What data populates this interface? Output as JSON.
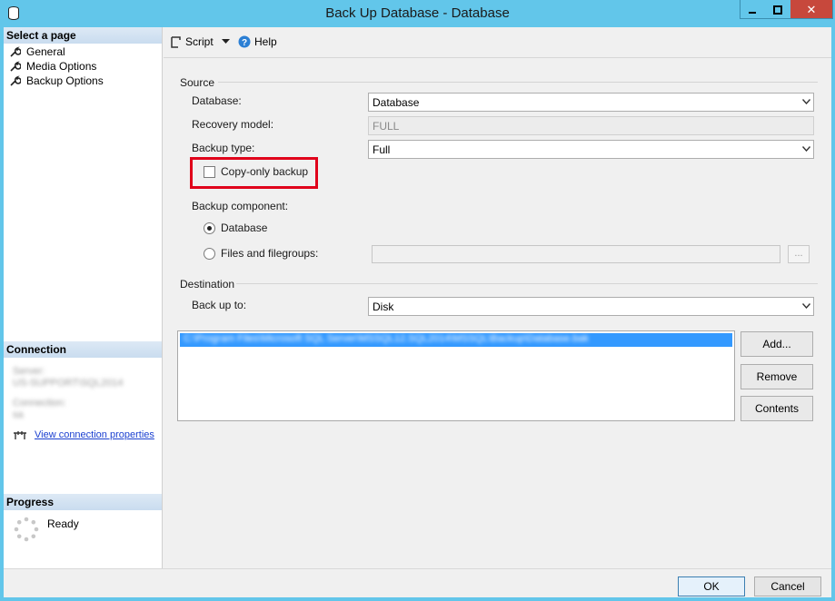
{
  "window": {
    "title": "Back Up Database - Database"
  },
  "sidebar": {
    "select_page_header": "Select a page",
    "pages": [
      {
        "label": "General",
        "icon": "wrench-icon"
      },
      {
        "label": "Media Options",
        "icon": "wrench-icon"
      },
      {
        "label": "Backup Options",
        "icon": "wrench-icon"
      }
    ],
    "connection_header": "Connection",
    "server_label": "Server:",
    "server_value": "US-SUPPORT\\SQL2014",
    "connection_label": "Connection:",
    "connection_value": "sa",
    "view_connection_link": "View connection properties",
    "progress_header": "Progress",
    "progress_status": "Ready"
  },
  "toolbar": {
    "script_label": "Script",
    "help_label": "Help"
  },
  "source": {
    "group_label": "Source",
    "database_label": "Database:",
    "database_value": "Database",
    "recovery_label": "Recovery model:",
    "recovery_value": "FULL",
    "backup_type_label": "Backup type:",
    "backup_type_value": "Full",
    "copy_only_label": "Copy-only backup",
    "copy_only_checked": false,
    "component_label": "Backup component:",
    "component_options": [
      {
        "label": "Database",
        "selected": true
      },
      {
        "label": "Files and filegroups:",
        "selected": false
      }
    ],
    "ellipsis_label": "..."
  },
  "destination": {
    "group_label": "Destination",
    "backup_to_label": "Back up to:",
    "backup_to_value": "Disk",
    "items": [
      "C:\\Program Files\\Microsoft SQL Server\\MSSQL12.SQL2014\\MSSQL\\Backup\\Database.bak"
    ],
    "add_label": "Add...",
    "remove_label": "Remove",
    "contents_label": "Contents"
  },
  "footer": {
    "ok_label": "OK",
    "cancel_label": "Cancel"
  },
  "colors": {
    "title_bar": "#62c6ea",
    "close_button": "#c7483c",
    "highlight_box": "#e0001a",
    "selection": "#3399ff"
  }
}
